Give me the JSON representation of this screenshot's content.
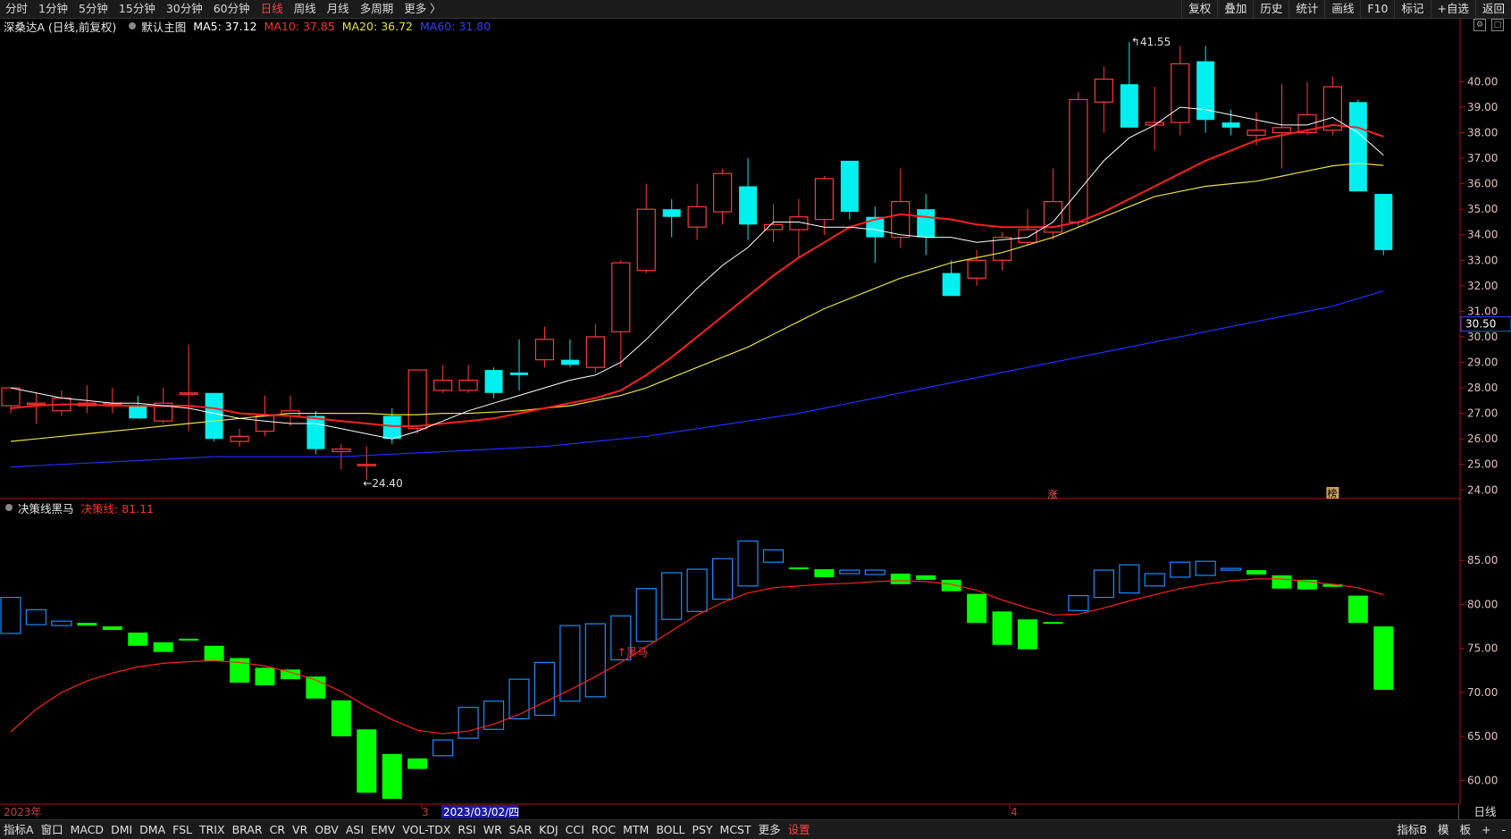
{
  "toolbar": {
    "tabs": [
      {
        "label": "分时",
        "active": false
      },
      {
        "label": "1分钟",
        "active": false
      },
      {
        "label": "5分钟",
        "active": false
      },
      {
        "label": "15分钟",
        "active": false
      },
      {
        "label": "30分钟",
        "active": false
      },
      {
        "label": "60分钟",
        "active": false
      },
      {
        "label": "日线",
        "active": true
      },
      {
        "label": "周线",
        "active": false
      },
      {
        "label": "月线",
        "active": false
      },
      {
        "label": "多周期",
        "active": false
      },
      {
        "label": "更多 〉",
        "active": false
      }
    ],
    "right_buttons": [
      "复权",
      "叠加",
      "历史",
      "统计",
      "画线",
      "F10",
      "标记",
      "+自选",
      "返回"
    ]
  },
  "main_legend": {
    "stock": "深桑达A (日线,前复权)",
    "template": "默认主图",
    "ma5": "MA5: 37.12",
    "ma10": "MA10: 37.85",
    "ma20": "MA20: 36.72",
    "ma60": "MA60: 31.80"
  },
  "indicator_legend": {
    "name": "决策线黑马",
    "value": "决策线: 81.11"
  },
  "price_axis": {
    "ticks": [
      "40.00",
      "39.00",
      "38.00",
      "37.00",
      "36.00",
      "35.00",
      "34.00",
      "33.00",
      "32.00",
      "31.00",
      "30.00",
      "29.00",
      "28.00",
      "27.00",
      "26.00",
      "25.00",
      "24.00"
    ],
    "current_tag": "30.50"
  },
  "indicator_axis": {
    "ticks": [
      "85.00",
      "80.00",
      "75.00",
      "70.00",
      "65.00",
      "60.00"
    ]
  },
  "annotations": {
    "high": "41.55",
    "low": "24.40",
    "zhang": "涨",
    "bang": "榜",
    "heima": "黑马"
  },
  "date_axis": {
    "year": "2023年",
    "m3": "3",
    "cursor": "2023/03/02/四",
    "m4": "4",
    "period": "日线"
  },
  "bottom": {
    "tabs": [
      "指标A",
      "窗口",
      "MACD",
      "DMI",
      "DMA",
      "FSL",
      "TRIX",
      "BRAR",
      "CR",
      "VR",
      "OBV",
      "ASI",
      "EMV",
      "VOL-TDX",
      "RSI",
      "WR",
      "SAR",
      "KDJ",
      "CCI",
      "ROC",
      "MTM",
      "BOLL",
      "PSY",
      "MCST",
      "更多",
      "设置"
    ],
    "right": [
      "指标B",
      "模",
      "板",
      "+",
      "-"
    ]
  },
  "colors": {
    "up": "#ff3a3a",
    "down": "#00f0f0",
    "ma5": "#ffffff",
    "ma10": "#ff2020",
    "ma20": "#e8e040",
    "ma60": "#2030ff",
    "ind_up_outline": "#1a8cff",
    "ind_down": "#00ff00"
  },
  "chart_data": [
    {
      "type": "candlestick",
      "title": "深桑达A (日线,前复权)",
      "ylim": [
        23.8,
        41.8
      ],
      "candles": [
        {
          "o": 27.3,
          "h": 27.9,
          "l": 27.0,
          "c": 28.0
        },
        {
          "o": 27.4,
          "h": 27.8,
          "l": 26.6,
          "c": 27.4
        },
        {
          "o": 27.1,
          "h": 27.9,
          "l": 26.9,
          "c": 27.6
        },
        {
          "o": 27.3,
          "h": 28.1,
          "l": 27.0,
          "c": 27.4
        },
        {
          "o": 27.4,
          "h": 28.0,
          "l": 27.0,
          "c": 27.4
        },
        {
          "o": 27.3,
          "h": 27.7,
          "l": 26.8,
          "c": 26.8
        },
        {
          "o": 26.7,
          "h": 28.0,
          "l": 26.6,
          "c": 27.4
        },
        {
          "o": 27.8,
          "h": 29.7,
          "l": 26.3,
          "c": 27.8
        },
        {
          "o": 27.8,
          "h": 27.8,
          "l": 25.9,
          "c": 26.0
        },
        {
          "o": 25.9,
          "h": 26.4,
          "l": 25.7,
          "c": 26.1
        },
        {
          "o": 26.3,
          "h": 27.7,
          "l": 26.1,
          "c": 26.9
        },
        {
          "o": 26.9,
          "h": 27.7,
          "l": 26.5,
          "c": 27.1
        },
        {
          "o": 26.9,
          "h": 27.1,
          "l": 25.4,
          "c": 25.6
        },
        {
          "o": 25.5,
          "h": 25.8,
          "l": 24.8,
          "c": 25.6
        },
        {
          "o": 25.0,
          "h": 25.7,
          "l": 24.4,
          "c": 25.0
        },
        {
          "o": 26.9,
          "h": 27.2,
          "l": 25.8,
          "c": 26.0
        },
        {
          "o": 26.4,
          "h": 28.7,
          "l": 26.2,
          "c": 28.7
        },
        {
          "o": 27.9,
          "h": 28.9,
          "l": 27.8,
          "c": 28.3
        },
        {
          "o": 27.9,
          "h": 28.9,
          "l": 27.8,
          "c": 28.3
        },
        {
          "o": 28.7,
          "h": 28.8,
          "l": 27.6,
          "c": 27.8
        },
        {
          "o": 28.6,
          "h": 29.9,
          "l": 27.9,
          "c": 28.5
        },
        {
          "o": 29.1,
          "h": 30.4,
          "l": 28.8,
          "c": 29.9
        },
        {
          "o": 29.1,
          "h": 29.9,
          "l": 28.8,
          "c": 28.9
        },
        {
          "o": 28.8,
          "h": 30.5,
          "l": 28.6,
          "c": 30.0
        },
        {
          "o": 30.2,
          "h": 33.0,
          "l": 28.8,
          "c": 32.9
        },
        {
          "o": 32.6,
          "h": 36.0,
          "l": 32.5,
          "c": 35.0
        },
        {
          "o": 35.0,
          "h": 35.4,
          "l": 33.9,
          "c": 34.7
        },
        {
          "o": 34.3,
          "h": 36.0,
          "l": 33.8,
          "c": 35.1
        },
        {
          "o": 34.9,
          "h": 36.6,
          "l": 34.4,
          "c": 36.4
        },
        {
          "o": 35.9,
          "h": 37.0,
          "l": 33.8,
          "c": 34.4
        },
        {
          "o": 34.2,
          "h": 35.2,
          "l": 33.7,
          "c": 34.4
        },
        {
          "o": 34.2,
          "h": 35.4,
          "l": 33.1,
          "c": 34.7
        },
        {
          "o": 34.6,
          "h": 36.3,
          "l": 34.0,
          "c": 36.2
        },
        {
          "o": 36.9,
          "h": 36.9,
          "l": 34.6,
          "c": 34.9
        },
        {
          "o": 34.7,
          "h": 35.1,
          "l": 32.9,
          "c": 33.9
        },
        {
          "o": 33.9,
          "h": 36.6,
          "l": 33.5,
          "c": 35.3
        },
        {
          "o": 35.0,
          "h": 35.6,
          "l": 33.2,
          "c": 33.9
        },
        {
          "o": 32.5,
          "h": 33.0,
          "l": 32.0,
          "c": 31.6
        },
        {
          "o": 32.3,
          "h": 33.4,
          "l": 32.0,
          "c": 33.0
        },
        {
          "o": 33.0,
          "h": 34.1,
          "l": 32.6,
          "c": 33.9
        },
        {
          "o": 33.7,
          "h": 35.0,
          "l": 33.6,
          "c": 34.2
        },
        {
          "o": 34.1,
          "h": 36.6,
          "l": 33.8,
          "c": 35.3
        },
        {
          "o": 34.5,
          "h": 39.6,
          "l": 34.3,
          "c": 39.3
        },
        {
          "o": 39.2,
          "h": 40.6,
          "l": 38.0,
          "c": 40.1
        },
        {
          "o": 39.9,
          "h": 41.55,
          "l": 38.3,
          "c": 38.2
        },
        {
          "o": 38.3,
          "h": 39.8,
          "l": 37.3,
          "c": 38.4
        },
        {
          "o": 38.4,
          "h": 41.4,
          "l": 37.9,
          "c": 40.7
        },
        {
          "o": 40.8,
          "h": 41.4,
          "l": 38.0,
          "c": 38.5
        },
        {
          "o": 38.4,
          "h": 38.9,
          "l": 37.9,
          "c": 38.2
        },
        {
          "o": 37.9,
          "h": 38.8,
          "l": 37.5,
          "c": 38.1
        },
        {
          "o": 38.0,
          "h": 39.9,
          "l": 36.6,
          "c": 38.2
        },
        {
          "o": 38.0,
          "h": 40.0,
          "l": 37.9,
          "c": 38.7
        },
        {
          "o": 38.1,
          "h": 40.2,
          "l": 37.9,
          "c": 39.8
        },
        {
          "o": 39.2,
          "h": 39.3,
          "l": 35.7,
          "c": 35.7
        },
        {
          "o": 35.6,
          "h": 35.6,
          "l": 33.2,
          "c": 33.4
        }
      ],
      "ma5": [
        28.0,
        27.8,
        27.6,
        27.5,
        27.4,
        27.4,
        27.3,
        27.2,
        27.0,
        26.8,
        26.7,
        26.6,
        26.6,
        26.4,
        26.2,
        26.0,
        26.3,
        26.7,
        27.1,
        27.4,
        27.7,
        28.0,
        28.3,
        28.5,
        29.0,
        29.9,
        30.9,
        31.9,
        32.8,
        33.5,
        34.5,
        34.5,
        34.3,
        34.3,
        34.2,
        34.0,
        33.9,
        33.9,
        33.7,
        33.8,
        33.9,
        34.5,
        35.7,
        36.9,
        37.8,
        38.3,
        39.0,
        38.9,
        38.7,
        38.5,
        38.3,
        38.3,
        38.6,
        38.0,
        37.12
      ],
      "ma10": [
        27.2,
        27.3,
        27.35,
        27.35,
        27.3,
        27.3,
        27.3,
        27.3,
        27.2,
        27.0,
        26.95,
        26.9,
        26.8,
        26.7,
        26.6,
        26.5,
        26.5,
        26.6,
        26.7,
        26.8,
        27.0,
        27.2,
        27.4,
        27.6,
        27.9,
        28.5,
        29.2,
        30.0,
        30.8,
        31.6,
        32.4,
        33.1,
        33.7,
        34.3,
        34.6,
        34.8,
        34.7,
        34.6,
        34.4,
        34.3,
        34.3,
        34.3,
        34.5,
        34.9,
        35.4,
        35.9,
        36.4,
        36.9,
        37.3,
        37.7,
        37.9,
        38.1,
        38.3,
        38.2,
        37.85
      ],
      "ma20": [
        25.9,
        26.0,
        26.1,
        26.2,
        26.3,
        26.4,
        26.5,
        26.6,
        26.7,
        26.8,
        26.9,
        27.0,
        27.0,
        27.0,
        27.0,
        26.95,
        26.95,
        27.0,
        27.0,
        27.05,
        27.1,
        27.2,
        27.3,
        27.5,
        27.7,
        28.0,
        28.4,
        28.8,
        29.2,
        29.6,
        30.1,
        30.6,
        31.1,
        31.5,
        31.9,
        32.3,
        32.6,
        32.9,
        33.1,
        33.3,
        33.6,
        33.9,
        34.3,
        34.7,
        35.1,
        35.5,
        35.7,
        35.9,
        36.0,
        36.1,
        36.3,
        36.5,
        36.7,
        36.8,
        36.72
      ],
      "ma60": [
        24.9,
        24.95,
        25.0,
        25.05,
        25.1,
        25.15,
        25.2,
        25.25,
        25.3,
        25.3,
        25.3,
        25.3,
        25.3,
        25.3,
        25.35,
        25.4,
        25.45,
        25.5,
        25.55,
        25.6,
        25.65,
        25.7,
        25.8,
        25.9,
        26.0,
        26.1,
        26.25,
        26.4,
        26.55,
        26.7,
        26.85,
        27.0,
        27.2,
        27.4,
        27.6,
        27.8,
        28.0,
        28.2,
        28.4,
        28.6,
        28.8,
        29.0,
        29.2,
        29.4,
        29.6,
        29.8,
        30.0,
        30.2,
        30.4,
        30.6,
        30.8,
        31.0,
        31.2,
        31.5,
        31.8
      ]
    },
    {
      "type": "candlestick",
      "title": "决策线黑马",
      "ylim": [
        57.5,
        90.0
      ],
      "bars": [
        {
          "o": 76.7,
          "c": 80.8
        },
        {
          "o": 77.7,
          "c": 79.4
        },
        {
          "o": 77.6,
          "c": 78.1
        },
        {
          "o": 77.9,
          "c": 77.6
        },
        {
          "o": 77.5,
          "c": 77.1
        },
        {
          "o": 76.8,
          "c": 75.3
        },
        {
          "o": 75.7,
          "c": 74.6
        },
        {
          "o": 76.1,
          "c": 75.9
        },
        {
          "o": 75.3,
          "c": 73.6
        },
        {
          "o": 73.9,
          "c": 71.1
        },
        {
          "o": 72.8,
          "c": 70.8
        },
        {
          "o": 72.6,
          "c": 71.5
        },
        {
          "o": 71.8,
          "c": 69.3
        },
        {
          "o": 69.1,
          "c": 65.0
        },
        {
          "o": 65.8,
          "c": 58.6
        },
        {
          "o": 63.0,
          "c": 57.9
        },
        {
          "o": 62.5,
          "c": 61.3
        },
        {
          "o": 62.8,
          "c": 64.6
        },
        {
          "o": 64.8,
          "c": 68.3
        },
        {
          "o": 65.8,
          "c": 69.0
        },
        {
          "o": 67.0,
          "c": 71.5
        },
        {
          "o": 67.4,
          "c": 73.4
        },
        {
          "o": 69.0,
          "c": 77.6
        },
        {
          "o": 69.5,
          "c": 77.8
        },
        {
          "o": 73.7,
          "c": 78.7
        },
        {
          "o": 75.8,
          "c": 81.8
        },
        {
          "o": 78.3,
          "c": 83.6
        },
        {
          "o": 79.2,
          "c": 84.0
        },
        {
          "o": 80.6,
          "c": 85.2
        },
        {
          "o": 82.1,
          "c": 87.2
        },
        {
          "o": 84.8,
          "c": 86.2
        },
        {
          "o": 84.2,
          "c": 84.0
        },
        {
          "o": 84.0,
          "c": 83.1
        },
        {
          "o": 83.5,
          "c": 83.9
        },
        {
          "o": 83.4,
          "c": 83.9
        },
        {
          "o": 83.5,
          "c": 82.3
        },
        {
          "o": 83.3,
          "c": 82.8
        },
        {
          "o": 82.8,
          "c": 81.5
        },
        {
          "o": 81.2,
          "c": 77.9
        },
        {
          "o": 79.2,
          "c": 75.4
        },
        {
          "o": 78.3,
          "c": 74.9
        },
        {
          "o": 78.0,
          "c": 77.8
        },
        {
          "o": 79.3,
          "c": 81.0
        },
        {
          "o": 80.8,
          "c": 83.9
        },
        {
          "o": 81.3,
          "c": 84.5
        },
        {
          "o": 82.1,
          "c": 83.5
        },
        {
          "o": 83.1,
          "c": 84.8
        },
        {
          "o": 83.3,
          "c": 84.9
        },
        {
          "o": 84.0,
          "c": 84.1
        },
        {
          "o": 83.9,
          "c": 83.4
        },
        {
          "o": 83.3,
          "c": 81.8
        },
        {
          "o": 82.8,
          "c": 81.7
        },
        {
          "o": 82.3,
          "c": 82.0
        },
        {
          "o": 81.0,
          "c": 77.9
        },
        {
          "o": 77.5,
          "c": 70.3
        }
      ],
      "decision_line": [
        65.5,
        68.1,
        70.0,
        71.3,
        72.2,
        72.9,
        73.3,
        73.5,
        73.6,
        73.4,
        73.0,
        72.3,
        71.4,
        70.1,
        68.4,
        66.9,
        65.7,
        65.3,
        65.6,
        66.4,
        67.5,
        68.9,
        70.3,
        71.8,
        73.4,
        75.2,
        77.0,
        78.8,
        80.2,
        81.3,
        81.9,
        82.1,
        82.3,
        82.4,
        82.6,
        82.7,
        82.6,
        82.3,
        81.6,
        80.5,
        79.6,
        78.8,
        78.9,
        79.6,
        80.4,
        81.1,
        81.8,
        82.3,
        82.7,
        82.9,
        82.9,
        82.6,
        82.3,
        81.9,
        81.11
      ]
    }
  ]
}
